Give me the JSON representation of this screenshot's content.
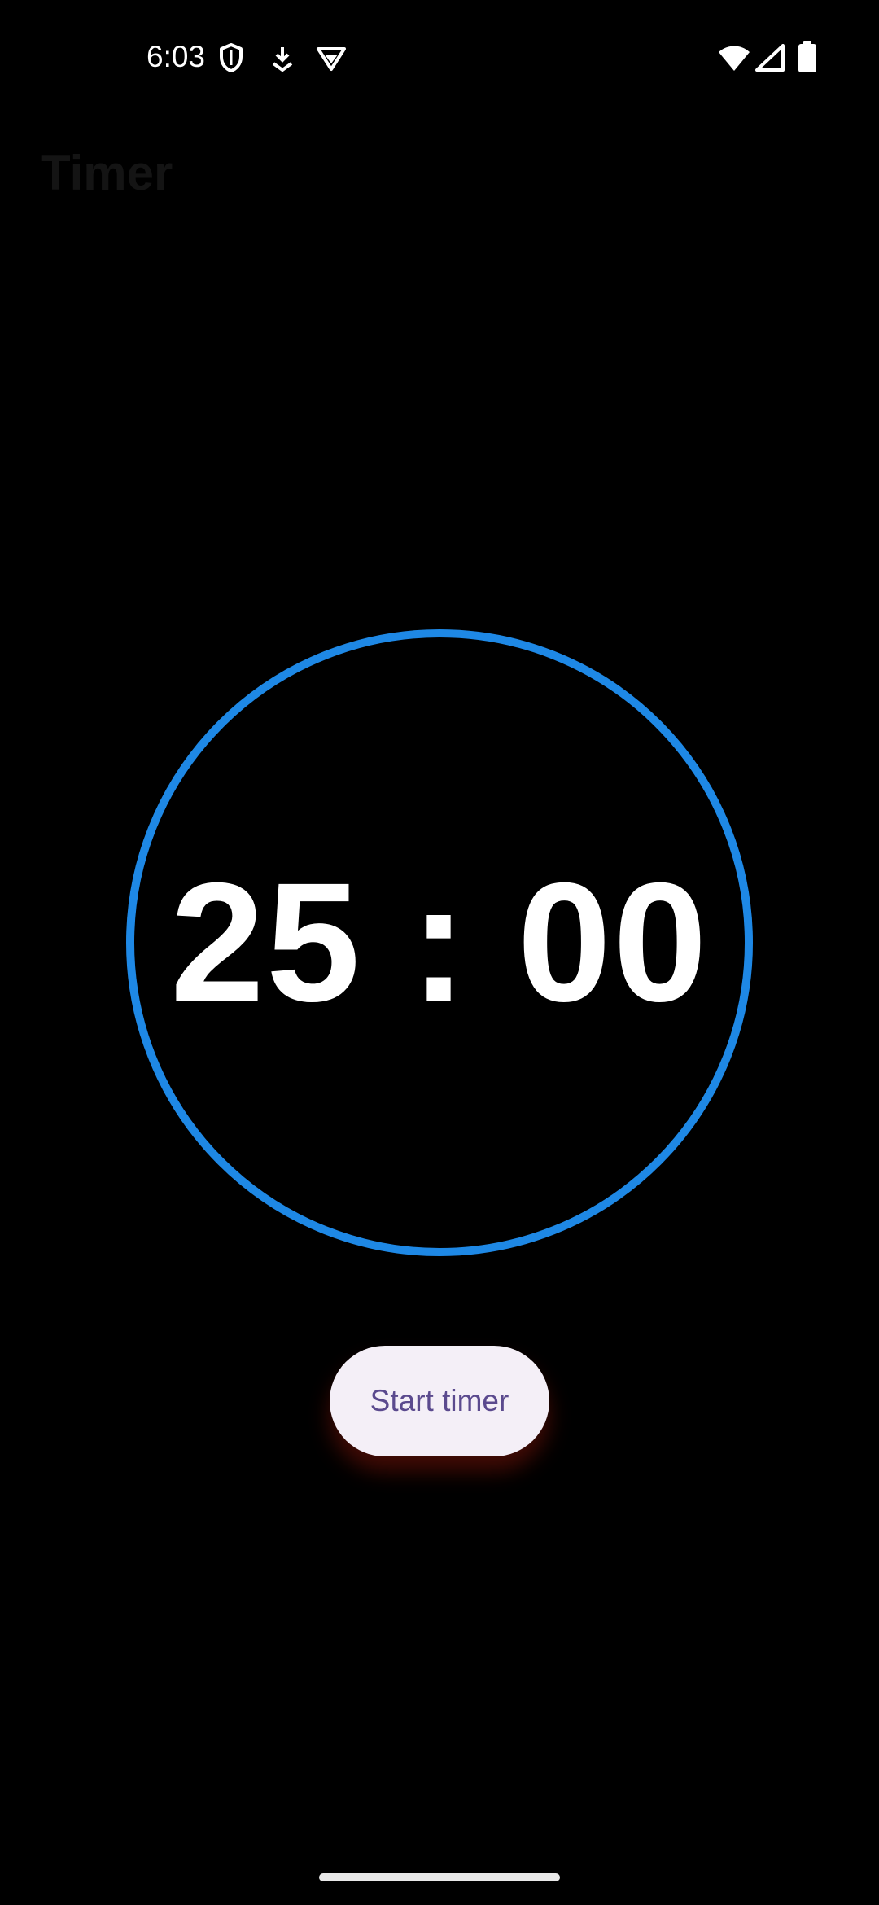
{
  "status_bar": {
    "time": "6:03",
    "left_icons": [
      "shield-icon",
      "download-icon",
      "vpn-icon"
    ],
    "right_icons": [
      "wifi-icon",
      "cellular-signal-icon",
      "battery-icon"
    ]
  },
  "app": {
    "title": "Timer"
  },
  "timer": {
    "display": "25 : 00",
    "ring_color": "#1E88E5",
    "progress": 1.0
  },
  "actions": {
    "start_label": "Start timer"
  },
  "colors": {
    "background": "#000000",
    "button_background": "#F4EFF7",
    "button_text": "#5B4A8E"
  }
}
